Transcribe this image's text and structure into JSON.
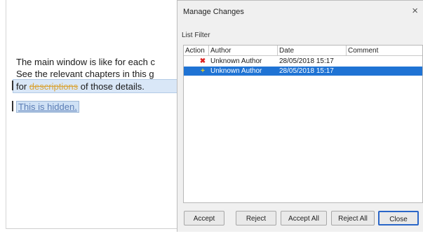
{
  "document": {
    "line1": "The main window is like for each c",
    "line2": "See the relevant chapters in this g",
    "line3_prefix": "for ",
    "line3_deleted": "descriptions",
    "line3_suffix": " of those details.",
    "line4_hidden": "This is hidden."
  },
  "dialog": {
    "title": "Manage Changes",
    "close_glyph": "×",
    "subtitle": "List  Filter",
    "columns": [
      "Action",
      "Author",
      "Date",
      "Comment"
    ],
    "rows": [
      {
        "action_icon": "delete-icon",
        "glyph": "✖",
        "author": "Unknown Author",
        "date": "28/05/2018 15:17",
        "comment": "",
        "selected": false
      },
      {
        "action_icon": "insert-icon",
        "glyph": "+",
        "author": "Unknown Author",
        "date": "28/05/2018 15:17",
        "comment": "",
        "selected": true
      }
    ],
    "buttons": {
      "accept": "Accept",
      "reject": "Reject",
      "accept_all": "Accept All",
      "reject_all": "Reject All",
      "close": "Close"
    }
  },
  "colors": {
    "selection": "#1f73d4",
    "deleted_text": "#d9a53a",
    "hidden_text": "#5b7db5",
    "delete_icon": "#dd2222",
    "insert_icon": "#f2d21a"
  }
}
